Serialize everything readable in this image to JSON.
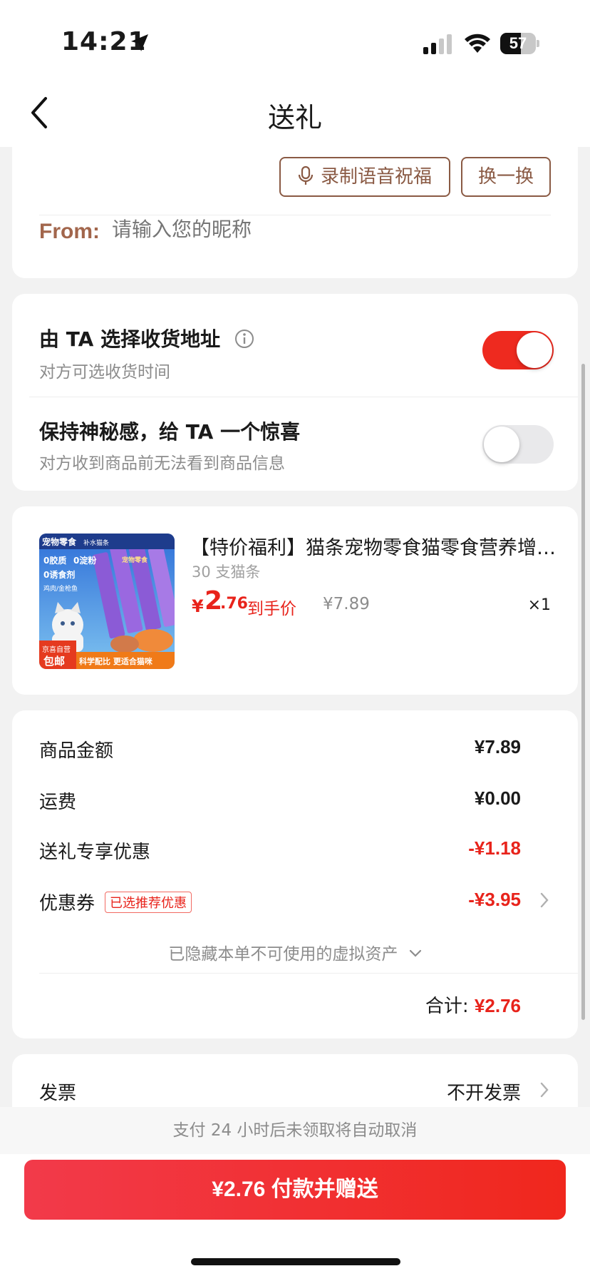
{
  "status_bar": {
    "time": "14:21",
    "battery_level": "57",
    "icons": [
      "location-arrow-icon",
      "cellular-signal-icon",
      "wifi-icon",
      "battery-icon"
    ]
  },
  "nav": {
    "title": "送礼",
    "back_icon": "chevron-left-icon"
  },
  "greeting": {
    "record_voice_label": "录制语音祝福",
    "shuffle_label": "换一换",
    "from_label": "From:",
    "nickname_placeholder": "请输入您的昵称",
    "nickname_value": ""
  },
  "options": [
    {
      "title": "由 TA 选择收货地址",
      "subtitle": "对方可选收货时间",
      "enabled": true,
      "has_info": true
    },
    {
      "title": "保持神秘感，给 TA 一个惊喜",
      "subtitle": "对方收到商品前无法看到商品信息",
      "enabled": false,
      "has_info": false
    }
  ],
  "product": {
    "title": "【特价福利】猫条宠物零食猫零食营养增…",
    "spec": "30 支猫条",
    "price_currency": "¥",
    "price_int": "2",
    "price_dec": ".76",
    "price_tag": "到手价",
    "original_price": "¥7.89",
    "quantity": "×1",
    "image_texts": {
      "top": "宠物零食",
      "top_sub": "补水猫条",
      "badge1": "0胶质",
      "badge2": "0淀粉",
      "badge3": "0诱食剂",
      "flavor": "鸡肉/金枪鱼",
      "bottom_left_top": "京喜自营",
      "bottom_left": "包邮",
      "bottom_right": "科学配比 更适合猫咪",
      "stick_label": "宠物零食"
    }
  },
  "summary": {
    "rows": [
      {
        "label": "商品金额",
        "value": "¥7.89",
        "red": false
      },
      {
        "label": "运费",
        "value": "¥0.00",
        "red": false
      },
      {
        "label": "送礼专享优惠",
        "value": "-¥1.18",
        "red": true
      },
      {
        "label": "优惠券",
        "badge": "已选推荐优惠",
        "value": "-¥3.95",
        "red": true,
        "chevron": true
      }
    ],
    "hidden_note": "已隐藏本单不可使用的虚拟资产",
    "total_label": "合计:",
    "total_value": "¥2.76"
  },
  "invoice": {
    "label": "发票",
    "value": "不开发票"
  },
  "footer": {
    "notice": "支付 24 小时后未领取将自动取消",
    "pay_button": "¥2.76 付款并赠送"
  },
  "colors": {
    "accent_red": "#e8231b",
    "brown": "#8a5a44",
    "toggle_on": "#ee2a1f",
    "toggle_off": "#e9e9eb"
  }
}
